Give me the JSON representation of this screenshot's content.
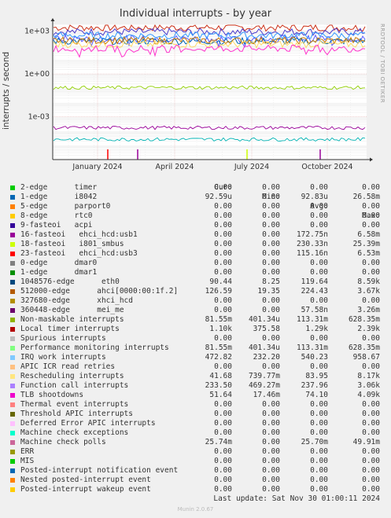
{
  "title": "Individual interrupts - by year",
  "side_label": "RRDTOOL / TOBI OETIKER",
  "footer": "Last update: Sat Nov 30 01:00:11 2024",
  "version": "Munin 2.0.67",
  "legend_header": {
    "cur": "Cur:",
    "min": "Min:",
    "avg": "Avg:",
    "max": "Max:"
  },
  "chart_data": {
    "type": "line",
    "title": "Individual interrupts - by year",
    "ylabel": "interrupts / second",
    "yscale": "log",
    "ylim": [
      1e-06,
      3000
    ],
    "y_ticks": [
      {
        "value": 0.001,
        "label": "1e-03"
      },
      {
        "value": 1,
        "label": "1e+00"
      },
      {
        "value": 1000,
        "label": "1e+03"
      }
    ],
    "x_ticks": [
      "January 2024",
      "April 2024",
      "July 2024",
      "October 2024"
    ],
    "grid": true,
    "approx_levels": [
      {
        "name": "Local timer interrupts",
        "color": "#cc3118",
        "value": 1800
      },
      {
        "name": "Performance monitoring interrupts",
        "color": "#4a3bcc",
        "value": 900
      },
      {
        "name": "Function call interrupts",
        "color": "#5a5aff",
        "value": 300
      },
      {
        "name": "1048576-edge eth0",
        "color": "#0066b3",
        "value": 200
      },
      {
        "name": "IRQ work interrupts",
        "color": "#3399ff",
        "value": 500
      },
      {
        "name": "512000-edge ahci",
        "color": "#cc7a00",
        "value": 220
      },
      {
        "name": "Rescheduling interrupts",
        "color": "#ffd966",
        "value": 120
      },
      {
        "name": "TLB shootdowns",
        "color": "#ff33cc",
        "value": 60
      },
      {
        "name": "Non-maskable interrupts",
        "color": "#8fce00",
        "value": 0.11
      },
      {
        "name": "16-fasteoi ehci_hcd:usb1",
        "color": "#990099",
        "value": 0.00017
      },
      {
        "name": "Machine check polls",
        "color": "#00b3b3",
        "value": 2.6e-05
      }
    ]
  },
  "legend": [
    {
      "color": "#00cc00",
      "label": "2-edge      timer",
      "cur": "0.00",
      "min": "0.00",
      "avg": "0.00",
      "max": "0.00"
    },
    {
      "color": "#0066b3",
      "label": "1-edge      i8042",
      "cur": "92.59u",
      "min": "0.00",
      "avg": "92.83u",
      "max": "26.58m"
    },
    {
      "color": "#ff8000",
      "label": "5-edge      parport0",
      "cur": "0.00",
      "min": "0.00",
      "avg": "0.00",
      "max": "0.00"
    },
    {
      "color": "#ffcc00",
      "label": "8-edge      rtc0",
      "cur": "0.00",
      "min": "0.00",
      "avg": "0.00",
      "max": "0.00"
    },
    {
      "color": "#330099",
      "label": "9-fasteoi   acpi",
      "cur": "0.00",
      "min": "0.00",
      "avg": "0.00",
      "max": "0.00"
    },
    {
      "color": "#990099",
      "label": "16-fasteoi   ehci_hcd:usb1",
      "cur": "0.00",
      "min": "0.00",
      "avg": "172.75n",
      "max": "6.58m"
    },
    {
      "color": "#ccff00",
      "label": "18-fasteoi   i801_smbus",
      "cur": "0.00",
      "min": "0.00",
      "avg": "230.33n",
      "max": "25.39m"
    },
    {
      "color": "#ff0000",
      "label": "23-fasteoi   ehci_hcd:usb3",
      "cur": "0.00",
      "min": "0.00",
      "avg": "115.16n",
      "max": "6.53m"
    },
    {
      "color": "#808080",
      "label": "0-edge      dmar0",
      "cur": "0.00",
      "min": "0.00",
      "avg": "0.00",
      "max": "0.00"
    },
    {
      "color": "#008f00",
      "label": "1-edge      dmar1",
      "cur": "0.00",
      "min": "0.00",
      "avg": "0.00",
      "max": "0.00"
    },
    {
      "color": "#00487d",
      "label": "1048576-edge      eth0",
      "cur": "90.44",
      "min": "8.25",
      "avg": "119.64",
      "max": "8.59k"
    },
    {
      "color": "#b35a00",
      "label": "512000-edge      ahci[0000:00:1f.2]",
      "cur": "126.59",
      "min": "19.35",
      "avg": "224.43",
      "max": "3.67k"
    },
    {
      "color": "#b38f00",
      "label": "327680-edge      xhci_hcd",
      "cur": "0.00",
      "min": "0.00",
      "avg": "0.00",
      "max": "0.00"
    },
    {
      "color": "#6b006b",
      "label": "360448-edge      mei_me",
      "cur": "0.00",
      "min": "0.00",
      "avg": "57.58n",
      "max": "3.26m"
    },
    {
      "color": "#8fb300",
      "label": "Non-maskable interrupts",
      "cur": "81.55m",
      "min": "401.34u",
      "avg": "113.31m",
      "max": "628.35m"
    },
    {
      "color": "#b30000",
      "label": "Local timer interrupts",
      "cur": "1.10k",
      "min": "375.58",
      "avg": "1.29k",
      "max": "2.39k"
    },
    {
      "color": "#bebebe",
      "label": "Spurious interrupts",
      "cur": "0.00",
      "min": "0.00",
      "avg": "0.00",
      "max": "0.00"
    },
    {
      "color": "#80ff80",
      "label": "Performance monitoring interrupts",
      "cur": "81.55m",
      "min": "401.34u",
      "avg": "113.31m",
      "max": "628.35m"
    },
    {
      "color": "#80c9ff",
      "label": "IRQ work interrupts",
      "cur": "472.82",
      "min": "232.20",
      "avg": "540.23",
      "max": "958.67"
    },
    {
      "color": "#ffc080",
      "label": "APIC ICR read retries",
      "cur": "0.00",
      "min": "0.00",
      "avg": "0.00",
      "max": "0.00"
    },
    {
      "color": "#ffe680",
      "label": "Rescheduling interrupts",
      "cur": "41.68",
      "min": "739.77m",
      "avg": "83.95",
      "max": "8.17k"
    },
    {
      "color": "#aa80ff",
      "label": "Function call interrupts",
      "cur": "233.50",
      "min": "469.27m",
      "avg": "237.96",
      "max": "3.06k"
    },
    {
      "color": "#ee00cc",
      "label": "TLB shootdowns",
      "cur": "51.64",
      "min": "17.46m",
      "avg": "74.10",
      "max": "4.09k"
    },
    {
      "color": "#ff8080",
      "label": "Thermal event interrupts",
      "cur": "0.00",
      "min": "0.00",
      "avg": "0.00",
      "max": "0.00"
    },
    {
      "color": "#666600",
      "label": "Threshold APIC interrupts",
      "cur": "0.00",
      "min": "0.00",
      "avg": "0.00",
      "max": "0.00"
    },
    {
      "color": "#ffbfff",
      "label": "Deferred Error APIC interrupts",
      "cur": "0.00",
      "min": "0.00",
      "avg": "0.00",
      "max": "0.00"
    },
    {
      "color": "#00ffcc",
      "label": "Machine check exceptions",
      "cur": "0.00",
      "min": "0.00",
      "avg": "0.00",
      "max": "0.00"
    },
    {
      "color": "#cc6699",
      "label": "Machine check polls",
      "cur": "25.74m",
      "min": "0.00",
      "avg": "25.70m",
      "max": "49.91m"
    },
    {
      "color": "#999900",
      "label": "ERR",
      "cur": "0.00",
      "min": "0.00",
      "avg": "0.00",
      "max": "0.00"
    },
    {
      "color": "#00cc00",
      "label": "MIS",
      "cur": "0.00",
      "min": "0.00",
      "avg": "0.00",
      "max": "0.00"
    },
    {
      "color": "#0066b3",
      "label": "Posted-interrupt notification event",
      "cur": "0.00",
      "min": "0.00",
      "avg": "0.00",
      "max": "0.00"
    },
    {
      "color": "#ff8000",
      "label": "Nested posted-interrupt event",
      "cur": "0.00",
      "min": "0.00",
      "avg": "0.00",
      "max": "0.00"
    },
    {
      "color": "#ffcc00",
      "label": "Posted-interrupt wakeup event",
      "cur": "0.00",
      "min": "0.00",
      "avg": "0.00",
      "max": "0.00"
    }
  ]
}
